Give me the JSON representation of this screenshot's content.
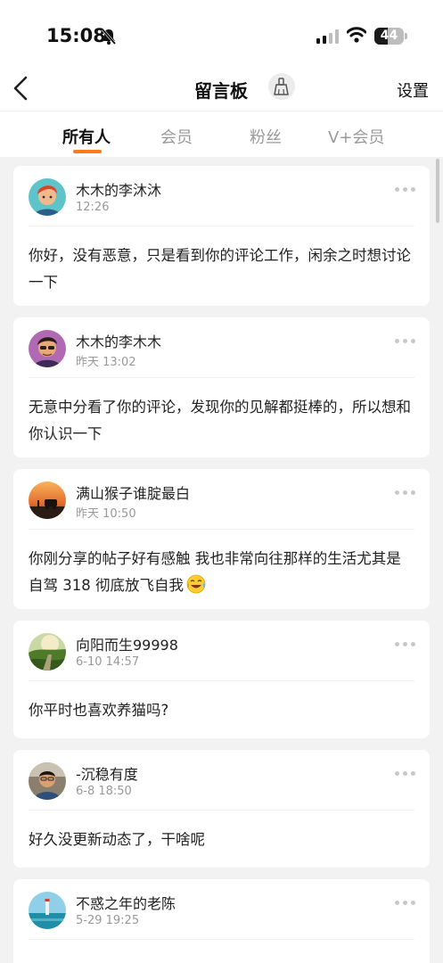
{
  "status": {
    "time": "15:08",
    "battery": "44",
    "battery_fraction": 0.44
  },
  "nav": {
    "title": "留言板",
    "settings": "设置"
  },
  "tabs": [
    {
      "label": "所有人",
      "active": true
    },
    {
      "label": "会员",
      "active": false
    },
    {
      "label": "粉丝",
      "active": false
    },
    {
      "label": "V+会员",
      "active": false
    }
  ],
  "messages": [
    {
      "name": "木木的李沐沐",
      "time": "12:26",
      "text": "你好，没有恶意，只是看到你的评论工作，闲余之时想讨论一下",
      "avatar": "cartoon-boy-teal"
    },
    {
      "name": "木木的李木木",
      "time": "昨天 13:02",
      "text": "无意中分看了你的评论，发现你的见解都挺棒的，所以想和你认识一下",
      "avatar": "cartoon-man-purple"
    },
    {
      "name": "满山猴子谁腚最白",
      "time": "昨天 10:50",
      "text": "你刚分享的帖子好有感触 我也非常向往那样的生活尤其是自驾 318 彻底放飞自我",
      "avatar": "sunset-car-photo",
      "emoji": "laughing-crying-emoji"
    },
    {
      "name": "向阳而生99998",
      "time": "6-10 14:57",
      "text": "你平时也喜欢养猫吗?",
      "avatar": "green-park-photo"
    },
    {
      "name": "-沉稳有度",
      "time": "6-8 18:50",
      "text": "好久没更新动态了，干啥呢",
      "avatar": "man-portrait-photo"
    },
    {
      "name": "不惑之年的老陈",
      "time": "5-29 19:25",
      "text": "",
      "avatar": "seaside-lighthouse-photo"
    }
  ]
}
